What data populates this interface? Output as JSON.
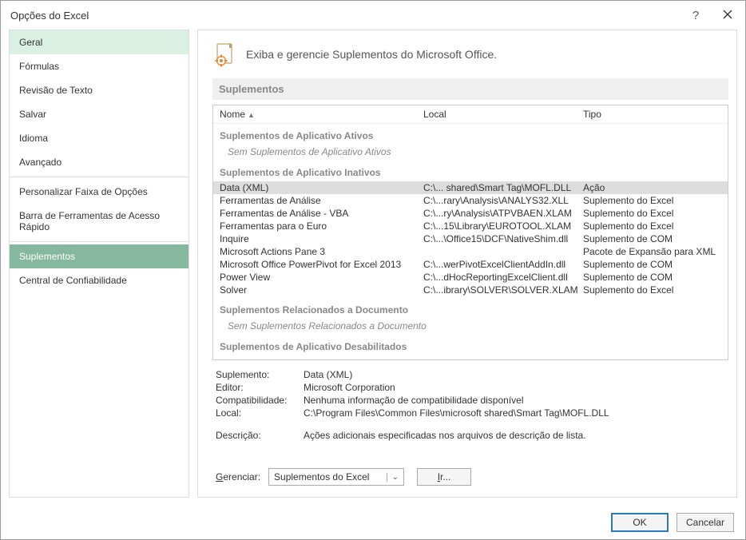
{
  "title": "Opções do Excel",
  "titlebar": {
    "help": "?",
    "close": "×"
  },
  "sidebar": {
    "items": [
      {
        "label": "Geral",
        "state": "hover"
      },
      {
        "label": "Fórmulas"
      },
      {
        "label": "Revisão de Texto"
      },
      {
        "label": "Salvar"
      },
      {
        "label": "Idioma"
      },
      {
        "label": "Avançado"
      },
      {
        "divider": true
      },
      {
        "label": "Personalizar Faixa de Opções"
      },
      {
        "label": "Barra de Ferramentas de Acesso Rápido"
      },
      {
        "divider": true
      },
      {
        "label": "Suplementos",
        "state": "selected"
      },
      {
        "label": "Central de Confiabilidade"
      }
    ]
  },
  "main": {
    "header": "Exiba e gerencie Suplementos do Microsoft Office.",
    "section_title": "Suplementos",
    "columns": {
      "nome": "Nome",
      "local": "Local",
      "tipo": "Tipo"
    },
    "groups": [
      {
        "title": "Suplementos de Aplicativo Ativos",
        "empty": "Sem Suplementos de Aplicativo Ativos",
        "rows": []
      },
      {
        "title": "Suplementos de Aplicativo Inativos",
        "rows": [
          {
            "nome": "Data (XML)",
            "local": "C:\\... shared\\Smart Tag\\MOFL.DLL",
            "tipo": "Ação",
            "selected": true
          },
          {
            "nome": "Ferramentas de Análise",
            "local": "C:\\...rary\\Analysis\\ANALYS32.XLL",
            "tipo": "Suplemento do Excel"
          },
          {
            "nome": "Ferramentas de Análise - VBA",
            "local": "C:\\...ry\\Analysis\\ATPVBAEN.XLAM",
            "tipo": "Suplemento do Excel"
          },
          {
            "nome": "Ferramentas para o Euro",
            "local": "C:\\...15\\Library\\EUROTOOL.XLAM",
            "tipo": "Suplemento do Excel"
          },
          {
            "nome": "Inquire",
            "local": "C:\\...\\Office15\\DCF\\NativeShim.dll",
            "tipo": "Suplemento de COM"
          },
          {
            "nome": "Microsoft Actions Pane 3",
            "local": "",
            "tipo": "Pacote de Expansão para XML"
          },
          {
            "nome": "Microsoft Office PowerPivot for Excel 2013",
            "local": "C:\\...werPivotExcelClientAddIn.dll",
            "tipo": "Suplemento de COM"
          },
          {
            "nome": "Power View",
            "local": "C:\\...dHocReportingExcelClient.dll",
            "tipo": "Suplemento de COM"
          },
          {
            "nome": "Solver",
            "local": "C:\\...ibrary\\SOLVER\\SOLVER.XLAM",
            "tipo": "Suplemento do Excel"
          }
        ]
      },
      {
        "title": "Suplementos Relacionados a Documento",
        "empty": "Sem Suplementos Relacionados a Documento",
        "rows": []
      },
      {
        "title": "Suplementos de Aplicativo Desabilitados",
        "rows": []
      }
    ],
    "details": {
      "labels": {
        "suplemento": "Suplemento:",
        "editor": "Editor:",
        "compat": "Compatibilidade:",
        "local": "Local:",
        "descricao": "Descrição:"
      },
      "values": {
        "suplemento": "Data (XML)",
        "editor": "Microsoft Corporation",
        "compat": "Nenhuma informação de compatibilidade disponível",
        "local": "C:\\Program Files\\Common Files\\microsoft shared\\Smart Tag\\MOFL.DLL",
        "descricao": "Ações adicionais especificadas nos arquivos de descrição de lista."
      }
    },
    "manage": {
      "label": "Gerenciar:",
      "selected": "Suplementos do Excel",
      "go": "Ir..."
    }
  },
  "footer": {
    "ok": "OK",
    "cancel": "Cancelar"
  }
}
